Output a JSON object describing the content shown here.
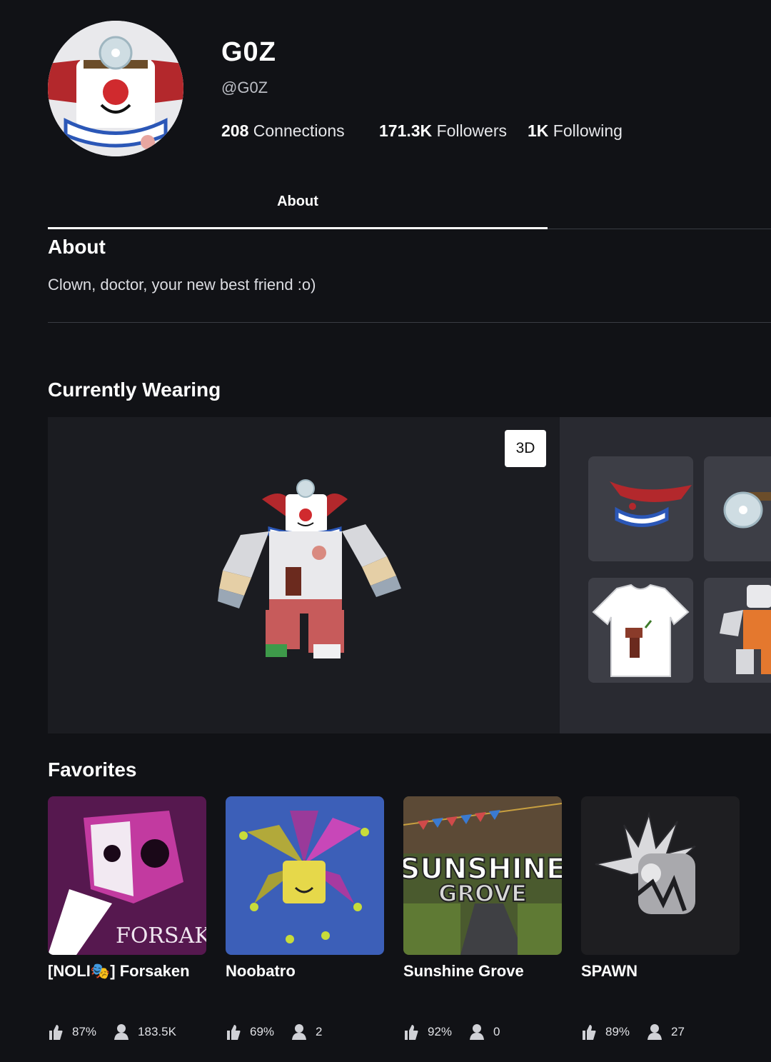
{
  "profile": {
    "display_name": "G0Z",
    "username": "@G0Z",
    "stats": {
      "connections_value": "208",
      "connections_label": "Connections",
      "followers_value": "171.3K",
      "followers_label": "Followers",
      "following_value": "1K",
      "following_label": "Following"
    }
  },
  "tabs": [
    {
      "label": "About"
    }
  ],
  "about": {
    "title": "About",
    "bio": "Clown, doctor, your new best friend :o)"
  },
  "wearing": {
    "title": "Currently Wearing",
    "view_toggle_label": "3D"
  },
  "favorites": {
    "title": "Favorites",
    "items": [
      {
        "name": "[NOLI🎭] Forsaken",
        "like_ratio": "87%",
        "players": "183.5K",
        "thumb_text": "FORSAKEN"
      },
      {
        "name": "Noobatro",
        "like_ratio": "69%",
        "players": "2"
      },
      {
        "name": "Sunshine Grove",
        "like_ratio": "92%",
        "players": "0",
        "thumb_text_1": "SUNSHINE",
        "thumb_text_2": "GROVE"
      },
      {
        "name": "SPAWN",
        "like_ratio": "89%",
        "players": "27"
      }
    ]
  },
  "colors": {
    "background": "#111216",
    "panel": "#1b1c21",
    "item_panel": "#292a31",
    "tile": "#3d3e46",
    "accent_white": "#ffffff"
  }
}
